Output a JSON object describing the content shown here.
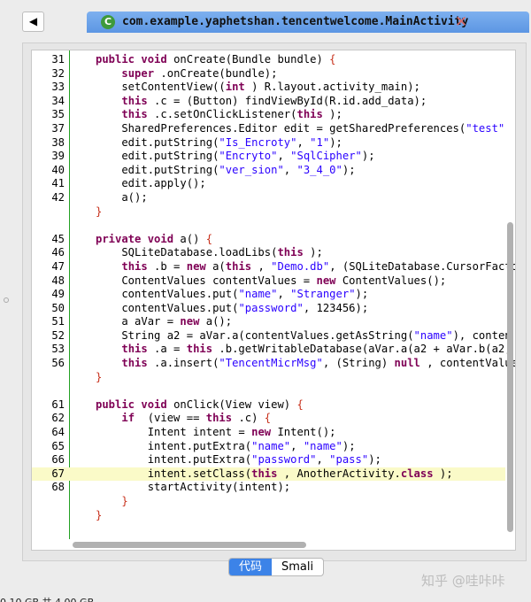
{
  "tab": {
    "back_label": "◀",
    "icon_label": "C",
    "title": "com.example.yaphetshan.tencentwelcome.MainActivity",
    "close_label": "✕"
  },
  "code_lines": [
    {
      "n": "31",
      "t": [
        [
          "kw",
          "public void"
        ],
        [
          "",
          "onCreate(Bundle bundle) "
        ],
        [
          "br",
          "{"
        ]
      ]
    },
    {
      "n": "32",
      "t": [
        [
          "",
          "    "
        ],
        [
          "kw",
          "super"
        ],
        [
          "",
          ".onCreate(bundle);"
        ]
      ]
    },
    {
      "n": "33",
      "t": [
        [
          "",
          "    setContentView(("
        ],
        [
          "kw",
          "int"
        ],
        [
          "",
          ") R.layout.activity_main);"
        ]
      ]
    },
    {
      "n": "34",
      "t": [
        [
          "",
          "    "
        ],
        [
          "kw",
          "this"
        ],
        [
          "",
          ".c = (Button) findViewById(R.id.add_data);"
        ]
      ]
    },
    {
      "n": "35",
      "t": [
        [
          "",
          "    "
        ],
        [
          "kw",
          "this"
        ],
        [
          "",
          ".c.setOnClickListener("
        ],
        [
          "kw",
          "this"
        ],
        [
          "",
          ");"
        ]
      ]
    },
    {
      "n": "37",
      "t": [
        [
          "",
          "    SharedPreferences.Editor edit = getSharedPreferences("
        ],
        [
          "str",
          "\"test\""
        ]
      ]
    },
    {
      "n": "38",
      "t": [
        [
          "",
          "    edit.putString("
        ],
        [
          "str",
          "\"Is_Encroty\""
        ],
        [
          "",
          ", "
        ],
        [
          "str",
          "\"1\""
        ],
        [
          "",
          ");"
        ]
      ]
    },
    {
      "n": "39",
      "t": [
        [
          "",
          "    edit.putString("
        ],
        [
          "str",
          "\"Encryto\""
        ],
        [
          "",
          ", "
        ],
        [
          "str",
          "\"SqlCipher\""
        ],
        [
          "",
          ");"
        ]
      ]
    },
    {
      "n": "40",
      "t": [
        [
          "",
          "    edit.putString("
        ],
        [
          "str",
          "\"ver_sion\""
        ],
        [
          "",
          ", "
        ],
        [
          "str",
          "\"3_4_0\""
        ],
        [
          "",
          ");"
        ]
      ]
    },
    {
      "n": "41",
      "t": [
        [
          "",
          "    edit.apply();"
        ]
      ]
    },
    {
      "n": "42",
      "t": [
        [
          "",
          "    a();"
        ]
      ]
    },
    {
      "n": "",
      "t": [
        [
          "br",
          "}"
        ]
      ]
    },
    {
      "n": "",
      "t": []
    },
    {
      "n": "45",
      "t": [
        [
          "kw",
          "private void"
        ],
        [
          "",
          "a() "
        ],
        [
          "br",
          "{"
        ]
      ]
    },
    {
      "n": "46",
      "t": [
        [
          "",
          "    SQLiteDatabase.loadLibs("
        ],
        [
          "kw",
          "this"
        ],
        [
          "",
          ");"
        ]
      ]
    },
    {
      "n": "47",
      "t": [
        [
          "",
          "    "
        ],
        [
          "kw",
          "this"
        ],
        [
          "",
          ".b = "
        ],
        [
          "kw",
          "new"
        ],
        [
          "",
          "a("
        ],
        [
          "kw",
          "this"
        ],
        [
          "",
          ", "
        ],
        [
          "str",
          "\"Demo.db\""
        ],
        [
          "",
          ", (SQLiteDatabase.CursorFacto"
        ]
      ]
    },
    {
      "n": "48",
      "t": [
        [
          "",
          "    ContentValues contentValues = "
        ],
        [
          "kw",
          "new"
        ],
        [
          "",
          "ContentValues();"
        ]
      ]
    },
    {
      "n": "49",
      "t": [
        [
          "",
          "    contentValues.put("
        ],
        [
          "str",
          "\"name\""
        ],
        [
          "",
          ", "
        ],
        [
          "str",
          "\"Stranger\""
        ],
        [
          "",
          ");"
        ]
      ]
    },
    {
      "n": "50",
      "t": [
        [
          "",
          "    contentValues.put("
        ],
        [
          "str",
          "\"password\""
        ],
        [
          "",
          ", 123456);"
        ]
      ]
    },
    {
      "n": "51",
      "t": [
        [
          "",
          "    a aVar = "
        ],
        [
          "kw",
          "new"
        ],
        [
          "",
          "a();"
        ]
      ]
    },
    {
      "n": "52",
      "t": [
        [
          "",
          "    String a2 = aVar.a(contentValues.getAsString("
        ],
        [
          "str",
          "\"name\""
        ],
        [
          "",
          "), conten"
        ]
      ]
    },
    {
      "n": "53",
      "t": [
        [
          "",
          "    "
        ],
        [
          "kw",
          "this"
        ],
        [
          "",
          ".a = "
        ],
        [
          "kw",
          "this"
        ],
        [
          "",
          ".b.getWritableDatabase(aVar.a(a2 + aVar.b(a2, c"
        ]
      ]
    },
    {
      "n": "56",
      "t": [
        [
          "",
          "    "
        ],
        [
          "kw",
          "this"
        ],
        [
          "",
          ".a.insert("
        ],
        [
          "str",
          "\"TencentMicrMsg\""
        ],
        [
          "",
          ", (String) "
        ],
        [
          "kw",
          "null"
        ],
        [
          "",
          ", contentValues"
        ]
      ]
    },
    {
      "n": "",
      "t": [
        [
          "br",
          "}"
        ]
      ]
    },
    {
      "n": "",
      "t": []
    },
    {
      "n": "61",
      "t": [
        [
          "kw",
          "public void"
        ],
        [
          "",
          "onClick(View view) "
        ],
        [
          "br",
          "{"
        ]
      ]
    },
    {
      "n": "62",
      "t": [
        [
          "",
          "    "
        ],
        [
          "kw",
          "if"
        ],
        [
          "",
          " (view == "
        ],
        [
          "kw",
          "this"
        ],
        [
          "",
          ".c) "
        ],
        [
          "br",
          "{"
        ]
      ]
    },
    {
      "n": "64",
      "t": [
        [
          "",
          "        Intent intent = "
        ],
        [
          "kw",
          "new"
        ],
        [
          "",
          "Intent();"
        ]
      ]
    },
    {
      "n": "65",
      "t": [
        [
          "",
          "        intent.putExtra("
        ],
        [
          "str",
          "\"name\""
        ],
        [
          "",
          ", "
        ],
        [
          "str",
          "\"name\""
        ],
        [
          "",
          ");"
        ]
      ]
    },
    {
      "n": "66",
      "t": [
        [
          "",
          "        intent.putExtra("
        ],
        [
          "str",
          "\"password\""
        ],
        [
          "",
          ", "
        ],
        [
          "str",
          "\"pass\""
        ],
        [
          "",
          ");"
        ]
      ]
    },
    {
      "n": "67",
      "t": [
        [
          "",
          "        intent.setClass("
        ],
        [
          "kw",
          "this"
        ],
        [
          "",
          ", AnotherActivity."
        ],
        [
          "kw",
          "class"
        ],
        [
          "",
          ");"
        ]
      ],
      "highlight": true
    },
    {
      "n": "68",
      "t": [
        [
          "",
          "        startActivity(intent);"
        ]
      ]
    },
    {
      "n": "",
      "t": [
        [
          "",
          "    "
        ],
        [
          "br",
          "}"
        ]
      ]
    },
    {
      "n": "",
      "t": [
        [
          "br",
          "}"
        ]
      ]
    }
  ],
  "view_toggle": {
    "code_label": "代码",
    "smali_label": "Smali",
    "active": "code"
  },
  "watermark": "知乎 @哇咔咔",
  "status_text": "0.10 GB 共 4.00 GB",
  "colors": {
    "keyword": "#7f0055",
    "string": "#2a00ff",
    "brace": "#c8311c",
    "highlight_line": "#fafac8",
    "tab_blue": "#5c96e3",
    "toggle_active": "#3c83e8"
  }
}
